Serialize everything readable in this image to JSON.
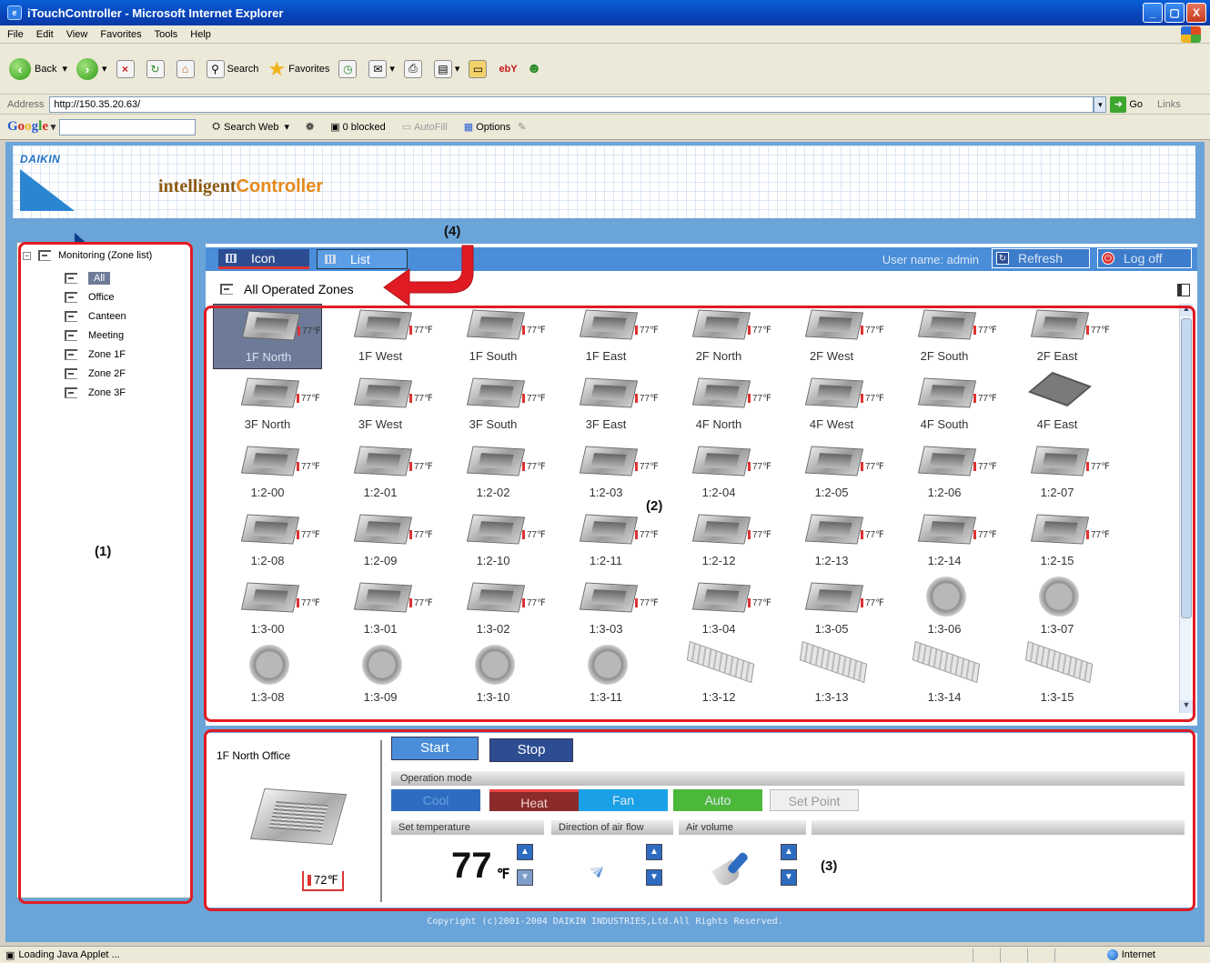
{
  "window": {
    "title": "iTouchController - Microsoft Internet Explorer",
    "buttons": [
      "_",
      "▢",
      "X"
    ]
  },
  "menu": [
    "File",
    "Edit",
    "View",
    "Favorites",
    "Tools",
    "Help"
  ],
  "toolbar": {
    "back": "Back",
    "search": "Search",
    "favorites": "Favorites"
  },
  "address": {
    "label": "Address",
    "url": "http://150.35.20.63/",
    "go": "Go",
    "links": "Links"
  },
  "googlebar": {
    "search_web": "Search Web",
    "blocked": "0 blocked",
    "autofill": "AutoFill",
    "options": "Options"
  },
  "tree": {
    "root": "Monitoring (Zone list)",
    "items": [
      "All",
      "Office",
      "Canteen",
      "Meeting",
      "Zone 1F",
      "Zone 2F",
      "Zone 3F"
    ]
  },
  "main": {
    "tabs": {
      "icon": "Icon",
      "list": "List"
    },
    "user_name": "User name: admin",
    "refresh": "Refresh",
    "logoff": "Log off",
    "section_title": "All Operated Zones",
    "zone_temp": "77℉",
    "zones": [
      "1F North",
      "1F West",
      "1F South",
      "1F East",
      "2F North",
      "2F West",
      "2F South",
      "2F East",
      "3F North",
      "3F West",
      "3F South",
      "3F East",
      "4F North",
      "4F West",
      "4F South",
      "4F East",
      "1:2-00",
      "1:2-01",
      "1:2-02",
      "1:2-03",
      "1:2-04",
      "1:2-05",
      "1:2-06",
      "1:2-07",
      "1:2-08",
      "1:2-09",
      "1:2-10",
      "1:2-11",
      "1:2-12",
      "1:2-13",
      "1:2-14",
      "1:2-15",
      "1:3-00",
      "1:3-01",
      "1:3-02",
      "1:3-03",
      "1:3-04",
      "1:3-05",
      "1:3-06",
      "1:3-07",
      "1:3-08",
      "1:3-09",
      "1:3-10",
      "1:3-11",
      "1:3-12",
      "1:3-13",
      "1:3-14",
      "1:3-15"
    ]
  },
  "control": {
    "unit_name": "1F North Office",
    "room_temp": "72℉",
    "start": "Start",
    "stop": "Stop",
    "operation_mode": "Operation mode",
    "modes": {
      "cool": "Cool",
      "heat": "Heat",
      "fan": "Fan",
      "auto": "Auto",
      "setpoint": "Set Point"
    },
    "set_temperature_label": "Set temperature",
    "direction_label": "Direction of air flow",
    "volume_label": "Air volume",
    "set_temp_value": "77",
    "set_temp_unit": "℉"
  },
  "copyright": "Copyright (c)2001-2004 DAIKIN INDUSTRIES,Ltd.All Rights Reserved.",
  "brand": {
    "logo_word": "DAIKIN",
    "name_1": "intelligent",
    "name_2": "Controller"
  },
  "annotations": {
    "a1": "(1)",
    "a2": "(2)",
    "a3": "(3)",
    "a4": "(4)"
  },
  "status": {
    "left": "Loading Java Applet ...",
    "right": "Internet"
  },
  "colors": {
    "accent": "#4a8ed9",
    "annotation": "#e01b24",
    "page_bg": "#6aa4d8"
  }
}
